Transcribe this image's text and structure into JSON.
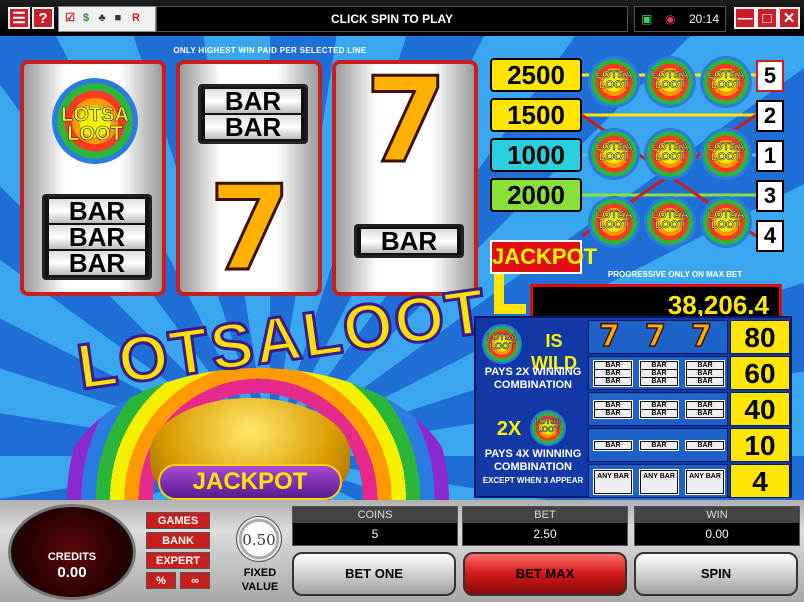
{
  "window": {
    "status_text": "CLICK SPIN TO PLAY",
    "clock": "20:14",
    "help_label": "?",
    "tool_r": "R"
  },
  "game": {
    "notice": "ONLY HIGHEST WIN PAID PER SELECTED LINE",
    "symbols": {
      "bar": "BAR",
      "seven": "7",
      "lotsa_loot": "LOTSA LOOT"
    },
    "reels": [
      {
        "top": "LOTSA LOOT",
        "bottom": "BAR BAR BAR"
      },
      {
        "top": "BAR BAR",
        "bottom": "7"
      },
      {
        "top": "7",
        "bottom": "BAR"
      }
    ],
    "pay_lines": [
      {
        "amount": "2500",
        "line": "5",
        "color": "#ffe600"
      },
      {
        "amount": "1500",
        "line": "2",
        "color": "#ffe600"
      },
      {
        "amount": "1000",
        "line": "1",
        "color": "#2ad0e0"
      },
      {
        "amount": "2000",
        "line": "3",
        "color": "#8ae03a"
      }
    ],
    "jackpot_line": "4",
    "jackpot_label": "JACKPOT",
    "progressive_note": "PROGRESSIVE ONLY ON MAX BET",
    "jackpot_value": "38,206.4",
    "logo_text": "LOTSALOOT",
    "pot_label": "JACKPOT",
    "paytable": {
      "wild_label": "IS WILD",
      "pays2x": "PAYS 2X WINNING COMBINATION",
      "two_x": "2X",
      "pays4x": "PAYS 4X WINNING COMBINATION",
      "except": "EXCEPT WHEN 3 APPEAR",
      "any_bar": "ANY BAR",
      "values": [
        "80",
        "60",
        "40",
        "10",
        "4"
      ]
    }
  },
  "console": {
    "credits_label": "CREDITS",
    "credits_value": "0.00",
    "side_buttons": [
      "GAMES",
      "BANK",
      "EXPERT",
      "%"
    ],
    "chip_value": "0.50",
    "fixed_value_label": "FIXED VALUE",
    "coins_label": "COINS",
    "coins_value": "5",
    "bet_label": "BET",
    "bet_value": "2.50",
    "win_label": "WIN",
    "win_value": "0.00",
    "bet_one": "BET ONE",
    "bet_max": "BET MAX",
    "spin": "SPIN"
  },
  "colors": {
    "accent_red": "#c81e1e",
    "jackpot_yellow": "#ffe600",
    "background_blue": "#1f6fd6"
  }
}
